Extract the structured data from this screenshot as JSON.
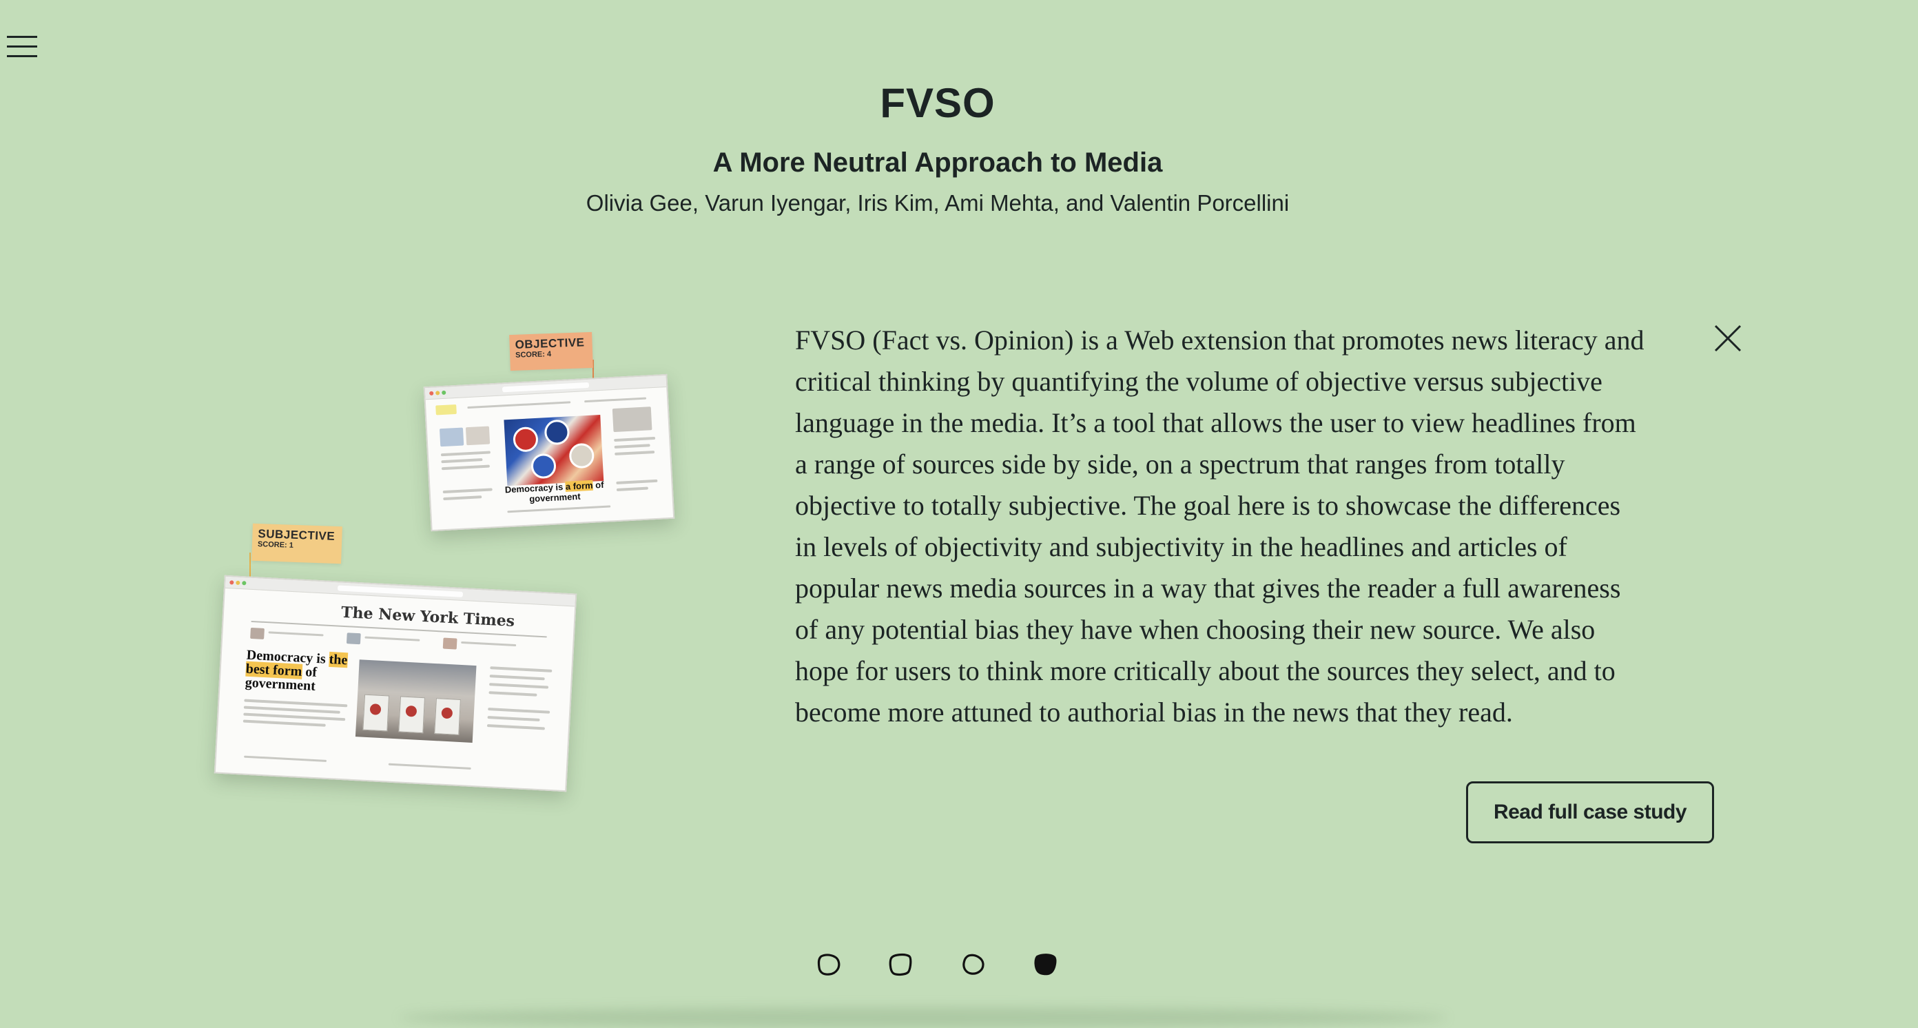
{
  "menu": {
    "icon": "hamburger-menu-icon"
  },
  "header": {
    "title": "FVSO",
    "subtitle": "A More Neutral Approach to Media",
    "authors": "Olivia Gee, Varun Iyengar, Iris Kim, Ami Mehta, and Valentin Porcellini"
  },
  "illustration": {
    "objective_tag": {
      "label": "OBJECTIVE",
      "score": "SCORE: 4"
    },
    "subjective_tag": {
      "label": "SUBJECTIVE",
      "score": "SCORE: 1"
    },
    "top_article": {
      "headline_before": "Democracy is ",
      "headline_highlight": "a form",
      "headline_after": " of government"
    },
    "bottom_article": {
      "logo": "The New York Times",
      "headline_before": "Democracy is ",
      "headline_highlight_1": "the",
      "headline_highlight_2": "best form",
      "headline_after": " of government"
    }
  },
  "description": "FVSO (Fact vs. Opinion) is a Web extension that promotes news literacy and critical thinking by quantifying the volume of objective versus subjective language in the media. It’s a tool that allows the user to view headlines from a range of sources side by side, on a spectrum that ranges from totally objective to totally subjective. The goal here is to showcase the differences in levels of objectivity and subjectivity in the headlines and articles of popular news media sources in a way that gives the reader a full awareness of any potential bias they have when choosing their new source. We also hope for users to think more critically about the sources they select, and to become more attuned to authorial bias in the news that they read.",
  "close": {
    "icon": "close-icon"
  },
  "cta": {
    "label": "Read full case study"
  },
  "pagination": {
    "count": 4,
    "active_index": 3
  },
  "colors": {
    "background": "#c3ddb9",
    "text": "#1c2424",
    "objective_tag": "#f0ad7f",
    "subjective_tag": "#f3cc85",
    "highlight": "#f4c450"
  }
}
